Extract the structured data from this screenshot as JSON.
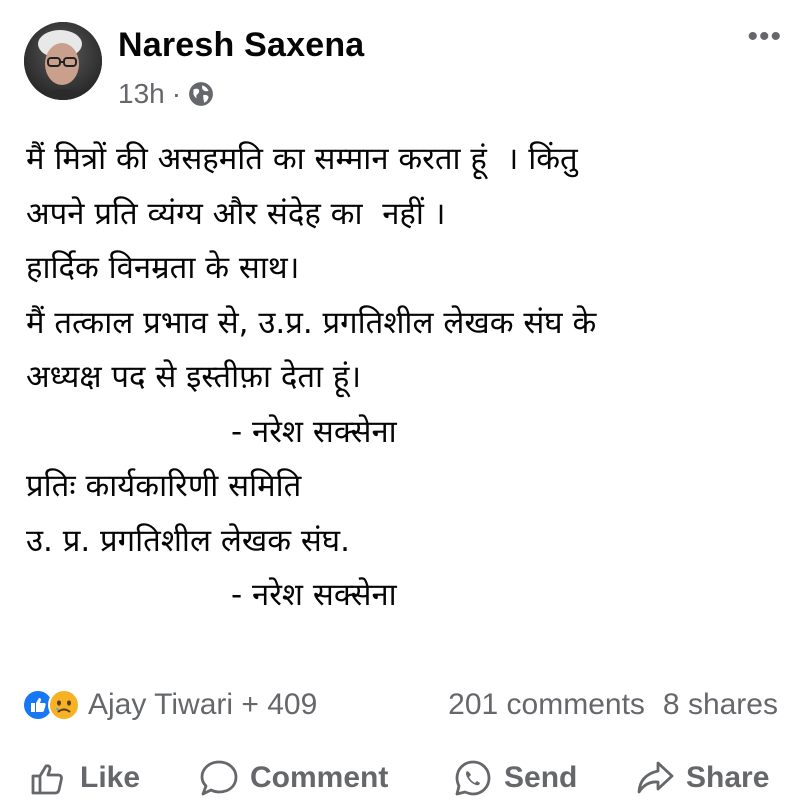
{
  "post": {
    "author": "Naresh Saxena",
    "time": "13h",
    "separator": "·",
    "privacy_icon": "globe-icon",
    "more_icon": "more-icon",
    "more_label": "•••",
    "body_lines": [
      "मैं मित्रों की असहमति का सम्मान करता हूं  । किंतु",
      "अपने प्रति व्यंग्य और संदेह का  नहीं ।",
      "हार्दिक विनम्रता के साथ।",
      "मैं तत्काल प्रभाव से, उ.प्र. प्रगतिशील लेखक संघ के",
      "अध्यक्ष पद से इस्तीफ़ा देता हूं।",
      "- नरेश सक्सेना",
      "प्रतिः कार्यकारिणी समिति",
      "उ. प्र. प्रगतिशील लेखक संघ.",
      "- नरेश सक्सेना"
    ]
  },
  "reactions": {
    "icons": [
      "like-reaction-icon",
      "sad-reaction-icon"
    ],
    "summary": "Ajay Tiwari + 409",
    "comments": "201 comments",
    "shares": "8 shares"
  },
  "actions": {
    "like": "Like",
    "comment": "Comment",
    "send": "Send",
    "share": "Share"
  },
  "colors": {
    "text": "#050505",
    "secondary": "#65676b",
    "like_blue": "#1877f2",
    "sad_yellow": "#f7b125"
  }
}
